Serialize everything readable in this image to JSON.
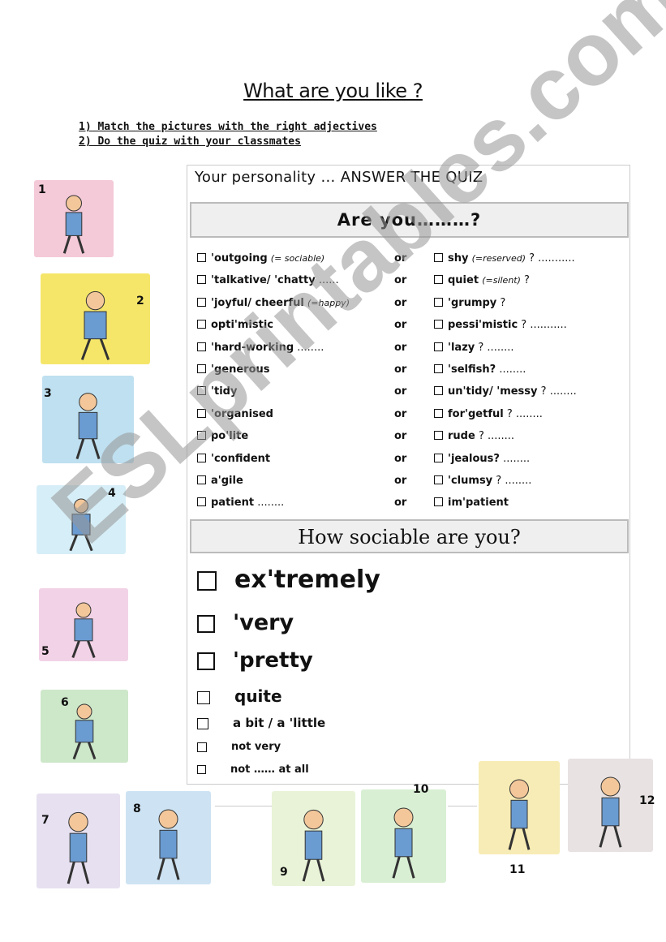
{
  "title": "What are you like ?",
  "instructions": [
    "1) Match the pictures with the right adjectives",
    "2) Do the quiz with your classmates"
  ],
  "quiz": {
    "intro": "Your personality … ANSWER THE QUIZ",
    "header1": "Are you………?",
    "or_label": "or",
    "rows": [
      {
        "left": "'outgoing",
        "left_note": "(= sociable)",
        "left_dots": "",
        "right": "shy",
        "right_note": "(=reserved)",
        "right_dots": "? ..........."
      },
      {
        "left": "'talkative/ 'chatty",
        "left_note": "",
        "left_dots": "......",
        "right": "quiet",
        "right_note": "(=silent)",
        "right_dots": "?"
      },
      {
        "left": "'joyful/ cheerful",
        "left_note": "(=happy)",
        "left_dots": "",
        "right": "'grumpy",
        "right_note": "",
        "right_dots": "?"
      },
      {
        "left": "opti'mistic",
        "left_note": "",
        "left_dots": "",
        "right": "pessi'mistic",
        "right_note": "",
        "right_dots": "? ..........."
      },
      {
        "left": "'hard-working",
        "left_note": "",
        "left_dots": "........",
        "right": "'lazy",
        "right_note": "",
        "right_dots": "? ........"
      },
      {
        "left": "'generous",
        "left_note": "",
        "left_dots": "",
        "right": "'selfish?",
        "right_note": "",
        "right_dots": "........"
      },
      {
        "left": "'tidy",
        "left_note": "",
        "left_dots": "",
        "right": "un'tidy/ 'messy",
        "right_note": "",
        "right_dots": "? ........"
      },
      {
        "left": "'organised",
        "left_note": "",
        "left_dots": "",
        "right": "for'getful",
        "right_note": "",
        "right_dots": "? ........"
      },
      {
        "left": "po'lite",
        "left_note": "",
        "left_dots": "",
        "right": "rude",
        "right_note": "",
        "right_dots": "? ........"
      },
      {
        "left": "'confident",
        "left_note": "",
        "left_dots": "",
        "right": "'jealous?",
        "right_note": "",
        "right_dots": "........"
      },
      {
        "left": "a'gile",
        "left_note": "",
        "left_dots": "",
        "right": "'clumsy",
        "right_note": "",
        "right_dots": "? ........"
      },
      {
        "left": "patient",
        "left_note": "",
        "left_dots": "........",
        "right": "im'patient",
        "right_note": "",
        "right_dots": ""
      }
    ],
    "header2": "How sociable are you?",
    "scale": [
      "ex'tremely",
      "'very",
      "'pretty",
      "quite",
      "a bit / a 'little",
      "not very",
      "not …… at all"
    ]
  },
  "pictures": [
    "1",
    "2",
    "3",
    "4",
    "5",
    "6",
    "7",
    "8",
    "9",
    "10",
    "11",
    "12"
  ],
  "watermark": "ESLprintables.com"
}
